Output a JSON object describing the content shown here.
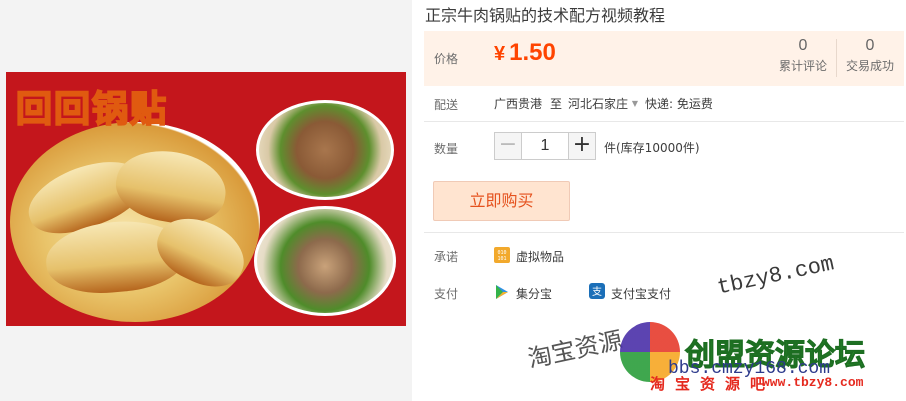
{
  "product": {
    "title": "正宗牛肉锅贴的技术配方视频教程",
    "image_text": "回回锅贴"
  },
  "price": {
    "label": "价格",
    "currency": "¥",
    "value": "1.50",
    "color": "#ff4400"
  },
  "stats": [
    {
      "value": "0",
      "label": "累计评论"
    },
    {
      "value": "0",
      "label": "交易成功"
    }
  ],
  "shipping": {
    "label": "配送",
    "from": "广西贵港",
    "to_word": "至",
    "destination": "河北石家庄",
    "dropdown_icon": "chevron-down-icon",
    "method": "快递: 免运费"
  },
  "quantity": {
    "label": "数量",
    "minus": "−",
    "value": "1",
    "plus": "+",
    "stock": "件(库存10000件)"
  },
  "buy_button": "立即购买",
  "promise": {
    "label": "承诺",
    "icon": "virtual-goods-icon",
    "text": "虚拟物品"
  },
  "payment": {
    "label": "支付",
    "methods": [
      {
        "icon": "jifenbao-icon",
        "text": "集分宝"
      },
      {
        "icon": "alipay-icon",
        "text": "支付宝支付"
      }
    ]
  },
  "watermark": {
    "url_top": "tbzy8.com",
    "taobao_text": "淘宝资源",
    "brand": "创盟资源论坛",
    "bbs": "bbs.cmzy168.com",
    "red_text": "淘宝资源吧",
    "url_bottom": "www.tbzy8.com"
  }
}
